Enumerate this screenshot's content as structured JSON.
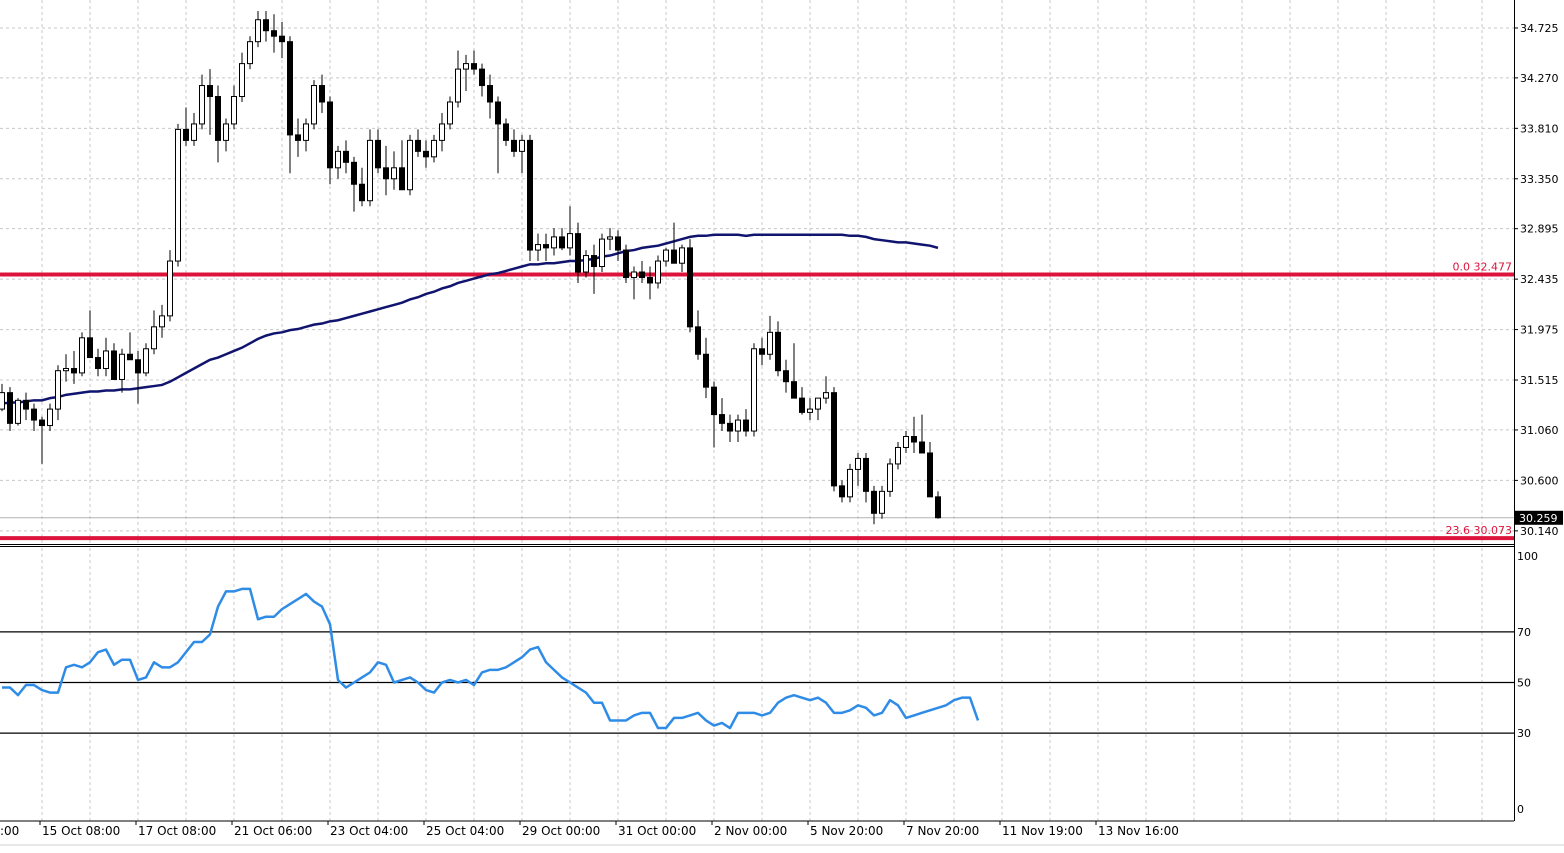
{
  "colors": {
    "background": "#ffffff",
    "grid": "#c8c8c8",
    "candle": "#000000",
    "moving_average": "#10146e",
    "fibo_line": "#dc143c",
    "rsi_line": "#2f8ce6",
    "rsi_levels": "#000000"
  },
  "chart_data": [
    {
      "type": "candlestick",
      "panel": "price",
      "grid": true,
      "ylim": [
        30.02,
        34.98
      ],
      "y_ticks": [
        "34.725",
        "34.270",
        "33.810",
        "33.350",
        "32.895",
        "32.435",
        "31.975",
        "31.515",
        "31.060",
        "30.600",
        "30.140"
      ],
      "current_price": "30.259",
      "bars_per_grid": 12,
      "candles": [
        [
          31.25,
          31.48,
          31.23,
          31.4
        ],
        [
          31.4,
          31.45,
          31.05,
          31.12
        ],
        [
          31.12,
          31.35,
          31.1,
          31.33
        ],
        [
          31.33,
          31.4,
          31.15,
          31.25
        ],
        [
          31.25,
          31.3,
          31.05,
          31.15
        ],
        [
          31.15,
          31.18,
          30.75,
          31.1
        ],
        [
          31.1,
          31.3,
          31.05,
          31.25
        ],
        [
          31.25,
          31.65,
          31.15,
          31.6
        ],
        [
          31.6,
          31.75,
          31.5,
          31.62
        ],
        [
          31.62,
          31.78,
          31.48,
          31.58
        ],
        [
          31.58,
          31.95,
          31.55,
          31.9
        ],
        [
          31.9,
          32.15,
          31.85,
          31.72
        ],
        [
          31.72,
          31.8,
          31.55,
          31.62
        ],
        [
          31.62,
          31.9,
          31.55,
          31.78
        ],
        [
          31.78,
          31.85,
          31.55,
          31.52
        ],
        [
          31.52,
          31.8,
          31.4,
          31.75
        ],
        [
          31.75,
          31.95,
          31.7,
          31.7
        ],
        [
          31.7,
          31.78,
          31.3,
          31.58
        ],
        [
          31.58,
          31.85,
          31.55,
          31.8
        ],
        [
          31.8,
          32.15,
          31.75,
          32.0
        ],
        [
          32.0,
          32.2,
          31.9,
          32.1
        ],
        [
          32.1,
          32.7,
          32.05,
          32.6
        ],
        [
          32.6,
          33.85,
          32.55,
          33.8
        ],
        [
          33.8,
          34.0,
          33.65,
          33.7
        ],
        [
          33.7,
          33.95,
          33.65,
          33.85
        ],
        [
          33.85,
          34.3,
          33.8,
          34.2
        ],
        [
          34.2,
          34.35,
          33.75,
          34.1
        ],
        [
          34.1,
          34.2,
          33.5,
          33.7
        ],
        [
          33.7,
          33.9,
          33.6,
          33.85
        ],
        [
          33.85,
          34.2,
          33.8,
          34.1
        ],
        [
          34.1,
          34.5,
          34.05,
          34.4
        ],
        [
          34.4,
          34.65,
          34.35,
          34.6
        ],
        [
          34.6,
          34.88,
          34.55,
          34.8
        ],
        [
          34.8,
          34.88,
          34.6,
          34.7
        ],
        [
          34.7,
          34.85,
          34.5,
          34.65
        ],
        [
          34.65,
          34.78,
          34.45,
          34.6
        ],
        [
          34.6,
          34.65,
          33.4,
          33.75
        ],
        [
          33.75,
          33.9,
          33.55,
          33.7
        ],
        [
          33.7,
          33.9,
          33.6,
          33.85
        ],
        [
          33.85,
          34.25,
          33.8,
          34.2
        ],
        [
          34.2,
          34.3,
          33.95,
          34.05
        ],
        [
          34.05,
          34.1,
          33.3,
          33.45
        ],
        [
          33.45,
          33.65,
          33.35,
          33.6
        ],
        [
          33.6,
          33.7,
          33.4,
          33.5
        ],
        [
          33.5,
          33.55,
          33.05,
          33.3
        ],
        [
          33.3,
          33.45,
          33.1,
          33.15
        ],
        [
          33.15,
          33.8,
          33.1,
          33.7
        ],
        [
          33.7,
          33.8,
          33.4,
          33.45
        ],
        [
          33.45,
          33.65,
          33.2,
          33.35
        ],
        [
          33.35,
          33.6,
          33.25,
          33.45
        ],
        [
          33.45,
          33.7,
          33.3,
          33.25
        ],
        [
          33.25,
          33.75,
          33.2,
          33.7
        ],
        [
          33.7,
          33.8,
          33.55,
          33.6
        ],
        [
          33.6,
          33.7,
          33.45,
          33.55
        ],
        [
          33.55,
          33.75,
          33.5,
          33.7
        ],
        [
          33.7,
          33.95,
          33.6,
          33.85
        ],
        [
          33.85,
          34.1,
          33.8,
          34.05
        ],
        [
          34.05,
          34.52,
          34.0,
          34.35
        ],
        [
          34.35,
          34.48,
          34.15,
          34.4
        ],
        [
          34.4,
          34.52,
          34.3,
          34.35
        ],
        [
          34.35,
          34.4,
          34.1,
          34.2
        ],
        [
          34.2,
          34.3,
          33.9,
          34.05
        ],
        [
          34.05,
          34.1,
          33.4,
          33.85
        ],
        [
          33.85,
          33.9,
          33.65,
          33.7
        ],
        [
          33.7,
          33.8,
          33.55,
          33.6
        ],
        [
          33.6,
          33.75,
          33.4,
          33.7
        ],
        [
          33.7,
          33.75,
          32.6,
          32.7
        ],
        [
          32.7,
          32.85,
          32.6,
          32.75
        ],
        [
          32.75,
          32.85,
          32.6,
          32.72
        ],
        [
          32.72,
          32.9,
          32.65,
          32.82
        ],
        [
          32.82,
          32.9,
          32.7,
          32.72
        ],
        [
          32.72,
          33.1,
          32.65,
          32.85
        ],
        [
          32.85,
          32.95,
          32.4,
          32.5
        ],
        [
          32.5,
          32.7,
          32.45,
          32.65
        ],
        [
          32.65,
          32.75,
          32.3,
          32.55
        ],
        [
          32.55,
          32.85,
          32.5,
          32.8
        ],
        [
          32.8,
          32.9,
          32.7,
          32.82
        ],
        [
          32.82,
          32.88,
          32.6,
          32.7
        ],
        [
          32.7,
          32.75,
          32.4,
          32.45
        ],
        [
          32.45,
          32.55,
          32.25,
          32.5
        ],
        [
          32.5,
          32.6,
          32.4,
          32.45
        ],
        [
          32.45,
          32.55,
          32.25,
          32.4
        ],
        [
          32.4,
          32.65,
          32.35,
          32.6
        ],
        [
          32.6,
          32.72,
          32.55,
          32.7
        ],
        [
          32.7,
          32.95,
          32.6,
          32.58
        ],
        [
          32.58,
          32.75,
          32.5,
          32.72
        ],
        [
          32.72,
          32.8,
          31.95,
          32.0
        ],
        [
          32.0,
          32.15,
          31.7,
          31.75
        ],
        [
          31.75,
          31.9,
          31.35,
          31.45
        ],
        [
          31.45,
          31.5,
          30.9,
          31.2
        ],
        [
          31.2,
          31.35,
          31.05,
          31.12
        ],
        [
          31.12,
          31.2,
          30.95,
          31.05
        ],
        [
          31.05,
          31.2,
          30.95,
          31.15
        ],
        [
          31.15,
          31.25,
          31.0,
          31.05
        ],
        [
          31.05,
          31.85,
          31.0,
          31.8
        ],
        [
          31.8,
          31.9,
          31.65,
          31.75
        ],
        [
          31.75,
          32.1,
          31.7,
          31.95
        ],
        [
          31.95,
          32.05,
          31.55,
          31.6
        ],
        [
          31.6,
          31.7,
          31.4,
          31.5
        ],
        [
          31.5,
          31.85,
          31.45,
          31.35
        ],
        [
          31.35,
          31.45,
          31.2,
          31.22
        ],
        [
          31.22,
          31.35,
          31.15,
          31.25
        ],
        [
          31.25,
          31.35,
          31.15,
          31.35
        ],
        [
          31.35,
          31.55,
          31.3,
          31.4
        ],
        [
          31.4,
          31.45,
          30.5,
          30.55
        ],
        [
          30.55,
          30.6,
          30.4,
          30.45
        ],
        [
          30.45,
          30.75,
          30.4,
          30.7
        ],
        [
          30.7,
          30.85,
          30.55,
          30.8
        ],
        [
          30.8,
          30.85,
          30.4,
          30.5
        ],
        [
          30.5,
          30.55,
          30.2,
          30.3
        ],
        [
          30.3,
          30.55,
          30.25,
          30.5
        ],
        [
          30.5,
          30.8,
          30.45,
          30.75
        ],
        [
          30.75,
          30.95,
          30.7,
          30.9
        ],
        [
          30.9,
          31.05,
          30.85,
          31.0
        ],
        [
          31.0,
          31.18,
          30.85,
          30.95
        ],
        [
          30.95,
          31.2,
          30.9,
          30.85
        ],
        [
          30.85,
          30.95,
          30.6,
          30.45
        ],
        [
          30.45,
          30.5,
          30.25,
          30.26
        ]
      ],
      "moving_average": [
        31.3,
        31.31,
        31.31,
        31.32,
        31.33,
        31.33,
        31.35,
        31.36,
        31.38,
        31.39,
        31.4,
        31.41,
        31.41,
        31.42,
        31.42,
        31.43,
        31.43,
        31.44,
        31.45,
        31.46,
        31.47,
        31.5,
        31.54,
        31.58,
        31.62,
        31.66,
        31.7,
        31.72,
        31.75,
        31.78,
        31.81,
        31.85,
        31.89,
        31.92,
        31.94,
        31.95,
        31.97,
        31.98,
        32.0,
        32.02,
        32.03,
        32.05,
        32.06,
        32.08,
        32.1,
        32.12,
        32.14,
        32.16,
        32.18,
        32.2,
        32.22,
        32.25,
        32.27,
        32.3,
        32.32,
        32.35,
        32.37,
        32.4,
        32.42,
        32.44,
        32.46,
        32.48,
        32.49,
        32.51,
        32.53,
        32.55,
        32.57,
        32.57,
        32.58,
        32.58,
        32.59,
        32.6,
        32.6,
        32.61,
        32.62,
        32.64,
        32.65,
        32.67,
        32.69,
        32.7,
        32.72,
        32.73,
        32.74,
        32.76,
        32.78,
        32.8,
        32.82,
        32.83,
        32.83,
        32.84,
        32.84,
        32.84,
        32.84,
        32.83,
        32.84,
        32.84,
        32.84,
        32.84,
        32.84,
        32.84,
        32.84,
        32.84,
        32.84,
        32.84,
        32.84,
        32.84,
        32.83,
        32.83,
        32.82,
        32.8,
        32.79,
        32.78,
        32.77,
        32.77,
        32.76,
        32.75,
        32.74,
        32.72
      ],
      "fibo_levels": [
        {
          "label": "0.0 32.477",
          "value": 32.477
        },
        {
          "label": "23.6 30.073",
          "value": 30.073
        }
      ],
      "x_ticks": [
        "15 Oct 08:00",
        "17 Oct 08:00",
        "21 Oct 06:00",
        "23 Oct 04:00",
        "25 Oct 04:00",
        "29 Oct 00:00",
        "31 Oct 00:00",
        "2 Nov 00:00",
        "5 Nov 20:00",
        "7 Nov 20:00",
        "11 Nov 19:00",
        "13 Nov 16:00"
      ],
      "x_tick_first_partial": ":00"
    },
    {
      "type": "line",
      "panel": "oscillator",
      "ylim": [
        0,
        100
      ],
      "y_ticks": [
        "100",
        "0"
      ],
      "levels": [
        "70",
        "50",
        "30"
      ],
      "series": [
        {
          "values": [
            48,
            48,
            45,
            49,
            49,
            47,
            46,
            46,
            56,
            57,
            56,
            58,
            62,
            63,
            57,
            59,
            59,
            51,
            52,
            58,
            56,
            56,
            58,
            62,
            66,
            66,
            69,
            80,
            86,
            86,
            87,
            87,
            75,
            76,
            76,
            79,
            81,
            83,
            85,
            82,
            80,
            73,
            51,
            48,
            50,
            52,
            54,
            58,
            57,
            50,
            51,
            52,
            50,
            47,
            46,
            50,
            51,
            50,
            51,
            49,
            54,
            55,
            55,
            56,
            58,
            60,
            63,
            64,
            58,
            55,
            52,
            50,
            48,
            46,
            42,
            42,
            35,
            35,
            35,
            37,
            38,
            38,
            32,
            32,
            36,
            36,
            37,
            38,
            35,
            33,
            34,
            32,
            38,
            38,
            38,
            37,
            38,
            42,
            44,
            45,
            44,
            43,
            44,
            42,
            38,
            38,
            39,
            41,
            40,
            37,
            38,
            43,
            41,
            36,
            37,
            38,
            39,
            40,
            41,
            43,
            44,
            44,
            35
          ]
        }
      ]
    }
  ]
}
